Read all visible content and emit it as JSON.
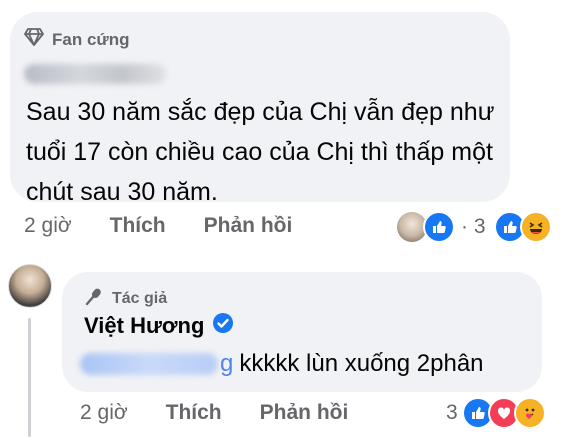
{
  "comment": {
    "badge_label": "Fan cứng",
    "badge_icon": "diamond-icon",
    "text": "Sau 30 năm sắc đẹp của Chị vẫn đẹp như tuổi 17 còn chiều cao của Chị thì thấp một chút sau 30 năm.",
    "time": "2 giờ",
    "like_label": "Thích",
    "reply_label": "Phản hồi",
    "reply_reactions": "· 3",
    "reactions": [
      "like",
      "haha"
    ]
  },
  "reply": {
    "badge_label": "Tác giả",
    "badge_icon": "microphone-icon",
    "author": "Việt Hương",
    "verified": true,
    "mention_tail": "g",
    "text": "kkkkk lùn xuống 2phân",
    "time": "2 giờ",
    "like_label": "Thích",
    "reply_label": "Phản hồi",
    "reaction_count": "3",
    "reactions": [
      "like",
      "love",
      "care"
    ]
  },
  "colors": {
    "bubble": "#f0f2f5",
    "meta_text": "#65676b",
    "like_blue": "#1877f2",
    "love_red": "#f33e58",
    "haha_yellow": "#f7b125",
    "mention_blue": "#4f84e8"
  }
}
